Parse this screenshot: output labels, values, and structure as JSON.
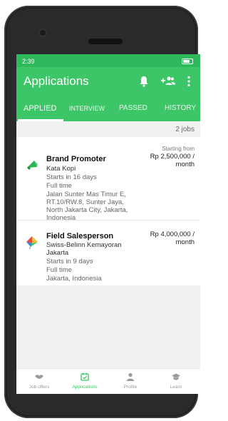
{
  "status": {
    "time": "2:39"
  },
  "appbar": {
    "title": "Applications"
  },
  "tabs": [
    {
      "label": "APPLIED",
      "active": true
    },
    {
      "label": "INTERVIEW"
    },
    {
      "label": "PASSED"
    },
    {
      "label": "HISTORY"
    }
  ],
  "list_header": {
    "count": "2 jobs"
  },
  "jobs": [
    {
      "title": "Brand Promoter",
      "company": "Kata Kopi",
      "starts": "Starts in 16 days",
      "type": "Full time",
      "address": "Jalan Sunter Mas Timur E, RT.10/RW.8, Sunter Jaya, North Jakarta City, Jakarta, Indonesia",
      "salary_label": "Starting from",
      "salary": "Rp 2,500,000 / month",
      "icon": "megaphone-icon"
    },
    {
      "title": "Field Salesperson",
      "company": "Swiss-Belinn Kemayoran Jakarta",
      "starts": "Starts in 9 days",
      "type": "Full time",
      "address": "Jakarta, Indonesia",
      "salary": "Rp 4,000,000 / month",
      "icon": "kite-icon"
    }
  ],
  "bottom_nav": [
    {
      "label": "Job offers",
      "icon": "handshake-icon"
    },
    {
      "label": "Applications",
      "icon": "calendar-check-icon",
      "active": true
    },
    {
      "label": "Profile",
      "icon": "person-icon"
    },
    {
      "label": "Learn",
      "icon": "graduation-cap-icon"
    }
  ],
  "colors": {
    "primary": "#3cc667",
    "status_bar": "#2fb85c",
    "inactive": "#9a9a9a"
  }
}
